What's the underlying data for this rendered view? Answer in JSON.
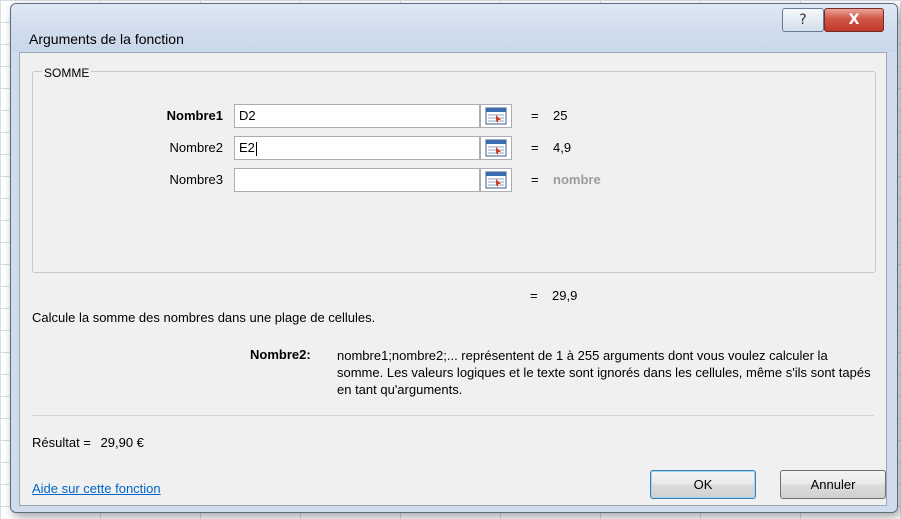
{
  "dialog": {
    "title": "Arguments de la fonction",
    "help_glyph": "?",
    "close_glyph": "X"
  },
  "function": {
    "name": "SOMME",
    "arguments": [
      {
        "label": "Nombre1",
        "value": "D2",
        "result": "25",
        "bold": true
      },
      {
        "label": "Nombre2",
        "value": "E2",
        "result": "4,9",
        "bold": false,
        "has_caret": true
      },
      {
        "label": "Nombre3",
        "value": "",
        "result": "nombre",
        "bold": false,
        "hint": true
      }
    ],
    "equals": "=",
    "total": "29,9",
    "description": "Calcule la somme des nombres dans une plage de cellules.",
    "arg_help_name": "Nombre2:",
    "arg_help_text": "nombre1;nombre2;... représentent de 1 à 255 arguments dont vous voulez calculer la somme. Les valeurs logiques et le texte sont ignorés dans les cellules, même s'ils sont tapés en tant qu'arguments."
  },
  "footer": {
    "result_label": "Résultat =",
    "result_value": "29,90 €",
    "help_link": "Aide sur cette fonction",
    "ok_label": "OK",
    "cancel_label": "Annuler"
  },
  "icons": {
    "ref_button": "collapse-dialog-icon",
    "help": "help-icon",
    "close": "close-icon"
  },
  "colors": {
    "title_bar": "#cfdcec",
    "close_button": "#c0392b",
    "link": "#0066cc",
    "hint_text": "#9c9c9c"
  }
}
